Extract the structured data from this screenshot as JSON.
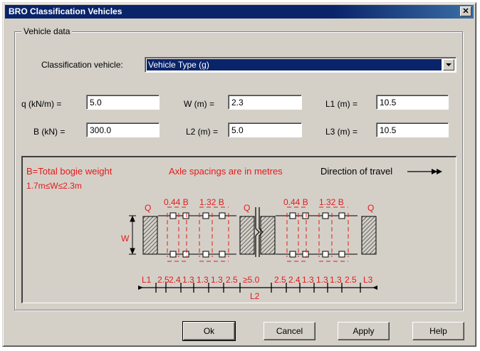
{
  "window": {
    "title": "BRO Classification Vehicles",
    "close_glyph": "✕"
  },
  "group": {
    "legend": "Vehicle data"
  },
  "classification": {
    "label": "Classification vehicle:",
    "value": "Vehicle Type (g)"
  },
  "fields": {
    "q": {
      "label": "q (kN/m) =",
      "value": "5.0"
    },
    "w": {
      "label": "W (m) =",
      "value": "2.3"
    },
    "l1": {
      "label": "L1 (m) =",
      "value": "10.5"
    },
    "b": {
      "label": "B (kN) =",
      "value": "300.0"
    },
    "l2": {
      "label": "L2 (m) =",
      "value": "5.0"
    },
    "l3": {
      "label": "L3 (m) =",
      "value": "10.5"
    }
  },
  "diagram": {
    "note_bogie": "B=Total bogie weight",
    "note_w_range": "1.7m≤W≤2.3m",
    "note_spacing": "Axle spacings are in metres",
    "direction": "Direction of travel",
    "q_label": "Q",
    "w_label": "W",
    "load_044": "0.44 B",
    "load_132": "1.32 B",
    "dim_l1": "L1",
    "dim_l2": "L2",
    "dim_l3": "L3",
    "dim_25": "2.5",
    "dim_24": "2.4",
    "dim_13": "1.3",
    "dim_ge50": "≥5.0",
    "colors": {
      "red": "#e41a1a",
      "black": "#000000"
    }
  },
  "buttons": {
    "ok": "Ok",
    "cancel": "Cancel",
    "apply": "Apply",
    "help": "Help"
  }
}
